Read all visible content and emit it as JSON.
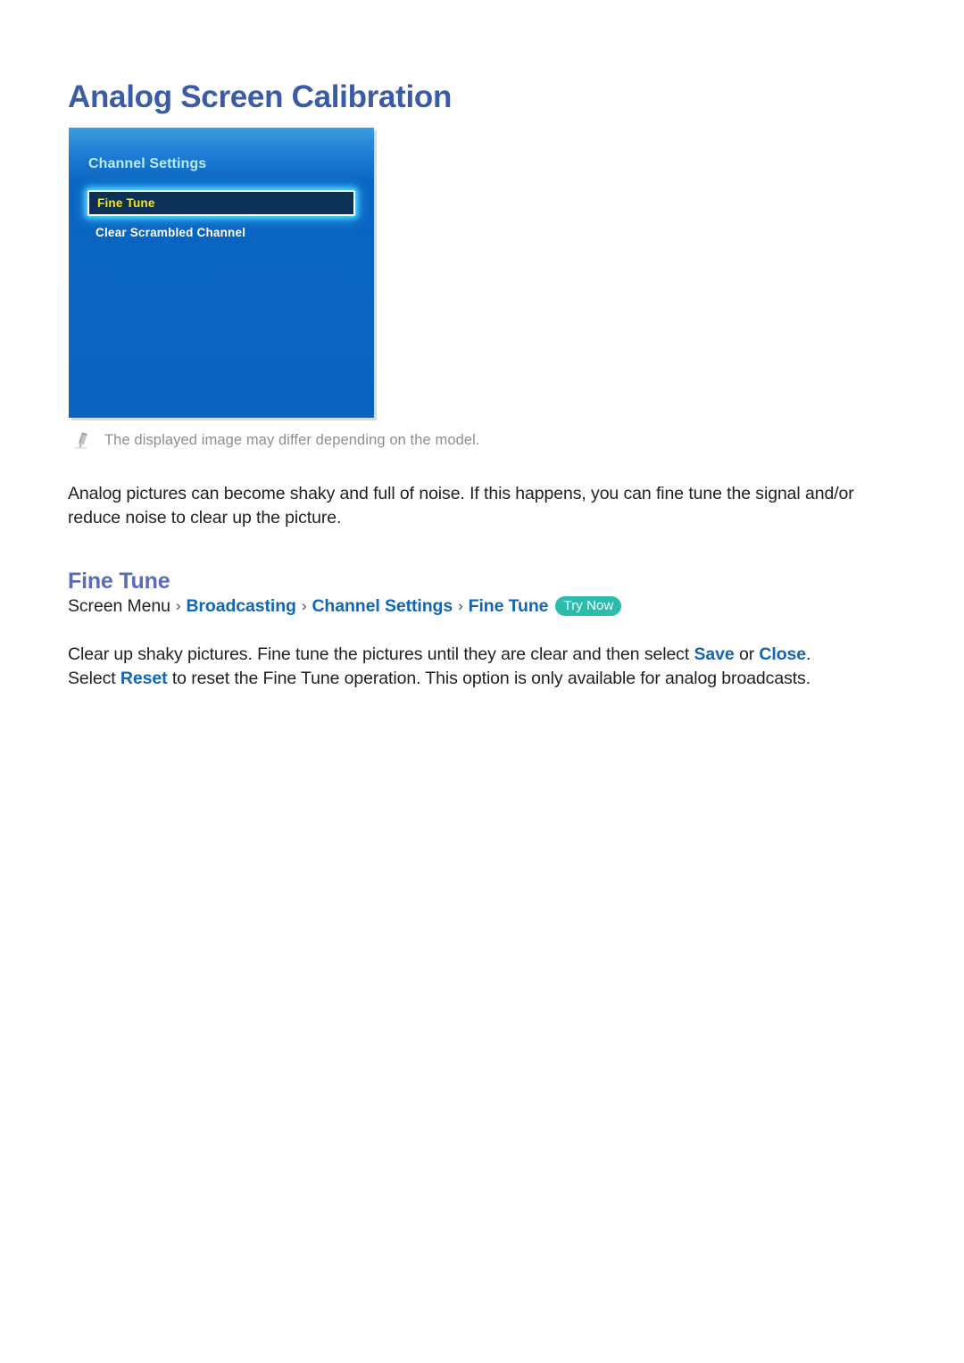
{
  "page": {
    "title": "Analog Screen Calibration"
  },
  "tv_menu": {
    "icon": "tv-menu-screenshot",
    "menu_title": "Channel Settings",
    "items": [
      {
        "label": "Fine Tune",
        "selected": true
      },
      {
        "label": "Clear Scrambled Channel",
        "selected": false
      }
    ]
  },
  "note": {
    "icon": "pencil-icon",
    "text": "The displayed image may differ depending on the model."
  },
  "intro_paragraph": "Analog pictures can become shaky and full of noise. If this happens, you can fine tune the signal and/or reduce noise to clear up the picture.",
  "section": {
    "heading": "Fine Tune",
    "breadcrumb": {
      "root": "Screen Menu",
      "separator": "›",
      "links": [
        "Broadcasting",
        "Channel Settings",
        "Fine Tune"
      ],
      "badge": "Try Now"
    },
    "detail": {
      "part1": "Clear up shaky pictures. Fine tune the pictures until they are clear and then select ",
      "link_save": "Save",
      "part2": " or ",
      "link_close": "Close",
      "part3": ". Select ",
      "link_reset": "Reset",
      "part4": " to reset the Fine Tune operation. This option is only available for analog broadcasts."
    }
  },
  "colors": {
    "title_blue": "#3b5ba5",
    "heading_blue": "#5b6bb5",
    "link_blue": "#1266b5",
    "badge_teal": "#2bbcae",
    "menu_blue": "#0a63bf",
    "selected_navy": "#0b2f55",
    "selected_yellow": "#ffe500",
    "menu_title_cyan": "#b8ecf7",
    "note_gray": "#8b8f95"
  }
}
